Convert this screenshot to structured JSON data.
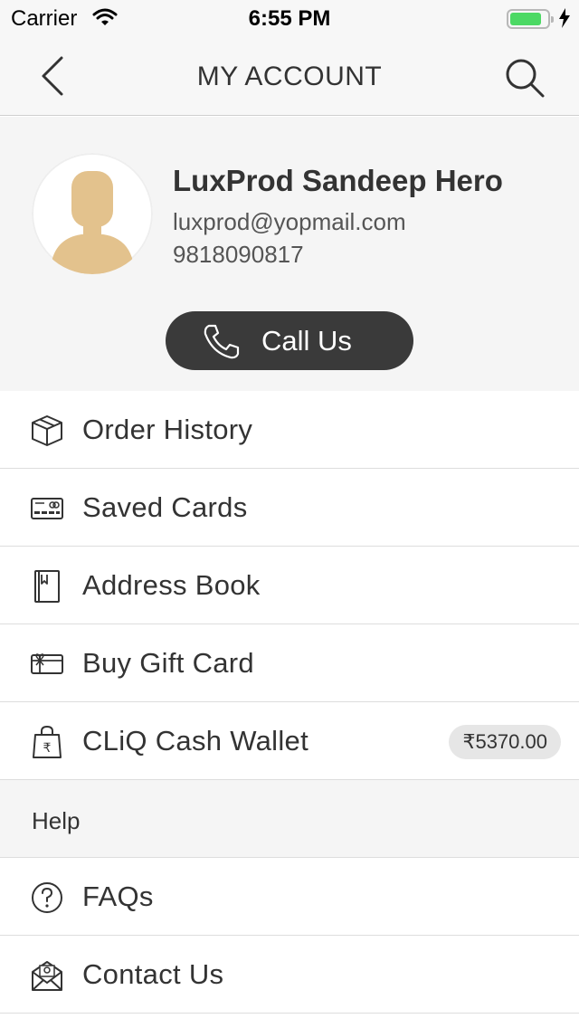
{
  "status_bar": {
    "carrier": "Carrier",
    "time": "6:55 PM",
    "battery_color": "#4cd964"
  },
  "nav": {
    "title": "MY ACCOUNT",
    "back_icon": "chevron-left-icon",
    "search_icon": "search-icon"
  },
  "profile": {
    "name": "LuxProd Sandeep Hero",
    "email": "luxprod@yopmail.com",
    "phone": "9818090817",
    "avatar_color": "#e3c28d",
    "call_button": "Call Us"
  },
  "menu": {
    "items": [
      {
        "label": "Order History",
        "icon": "box-icon"
      },
      {
        "label": "Saved Cards",
        "icon": "credit-card-icon"
      },
      {
        "label": "Address Book",
        "icon": "address-book-icon"
      },
      {
        "label": "Buy Gift Card",
        "icon": "gift-card-icon"
      },
      {
        "label": "CLiQ Cash Wallet",
        "icon": "wallet-bag-icon",
        "badge": "₹5370.00"
      }
    ],
    "help_header": "Help",
    "help_items": [
      {
        "label": "FAQs",
        "icon": "question-circle-icon"
      },
      {
        "label": "Contact Us",
        "icon": "envelope-icon"
      }
    ]
  }
}
